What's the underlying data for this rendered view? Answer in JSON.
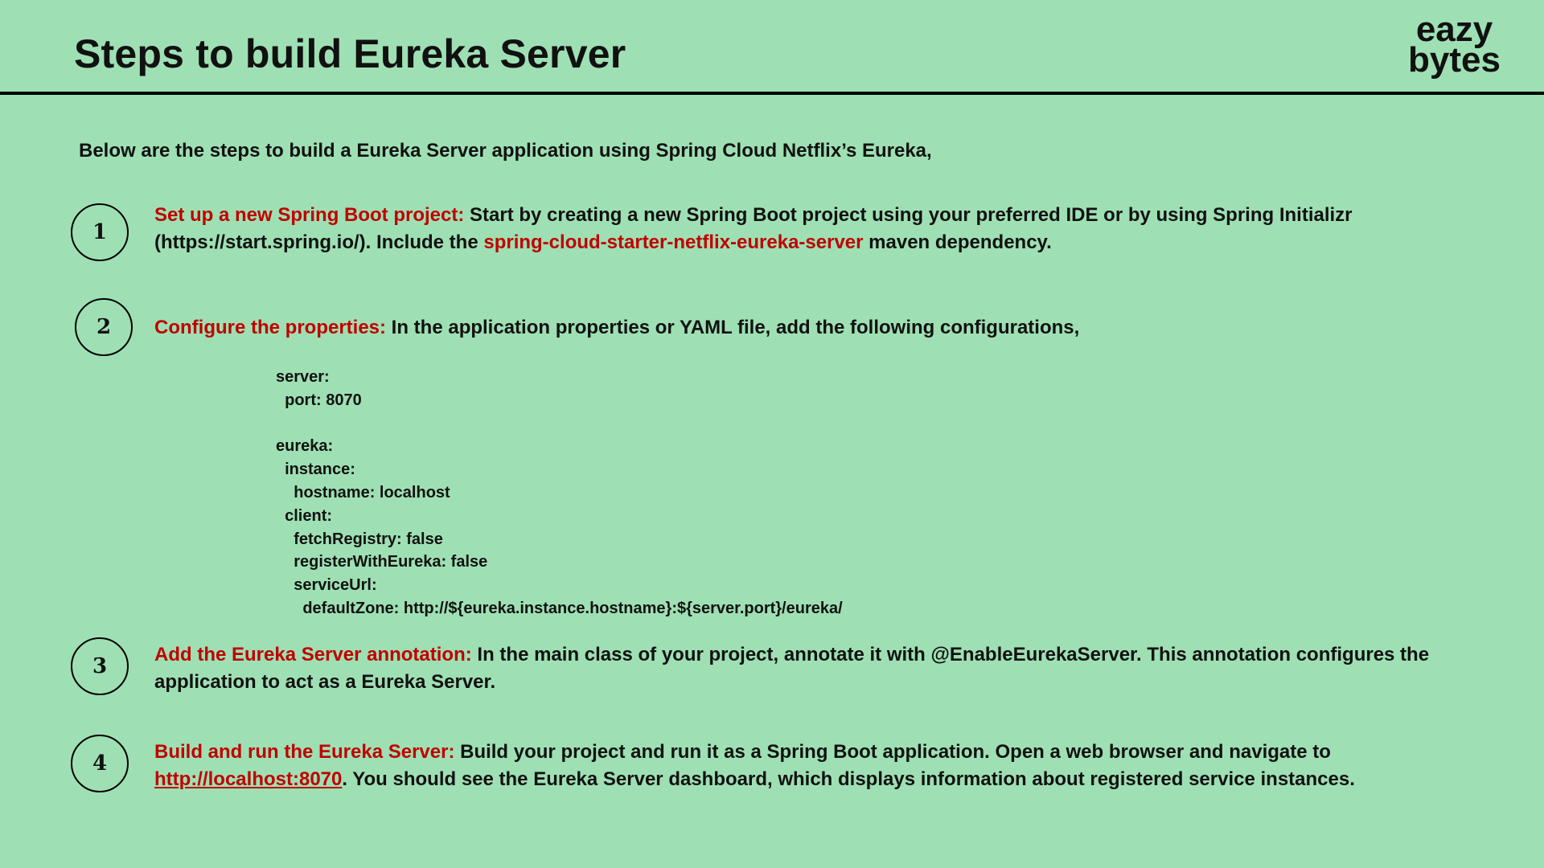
{
  "header": {
    "title": "Steps to build Eureka Server",
    "logo_line1": "eazy",
    "logo_line2": "bytes"
  },
  "intro": "Below are the steps to build a Eureka Server application using Spring Cloud Netflix’s Eureka,",
  "steps": [
    {
      "number": "1",
      "heading": "Set up a new Spring Boot project:",
      "text_a": " Start by creating a new Spring Boot project using your preferred IDE or by using Spring Initializr (https://start.spring.io/). Include the ",
      "highlight": "spring-cloud-starter-netflix-eureka-server",
      "text_b": " maven dependency."
    },
    {
      "number": "2",
      "heading": "Configure the properties:",
      "text": " In the application properties or YAML file, add the following configurations,"
    },
    {
      "number": "3",
      "heading": "Add the Eureka Server annotation:",
      "text": " In the main class of your project, annotate it with @EnableEurekaServer. This annotation configures the application to act as a Eureka Server."
    },
    {
      "number": "4",
      "heading": "Build and run the Eureka Server:",
      "text_a": " Build your project and run it as a Spring Boot application. Open a web browser and navigate to ",
      "link": "http://localhost:8070",
      "text_b": ". You should see the Eureka Server dashboard, which displays information about registered service instances."
    }
  ],
  "config_code": "server:\n  port: 8070\n\neureka:\n  instance:\n    hostname: localhost\n  client:\n    fetchRegistry: false\n    registerWithEureka: false\n    serviceUrl:\n      defaultZone: http://${eureka.instance.hostname}:${server.port}/eureka/",
  "colors": {
    "background": "#9ee0b4",
    "highlight": "#c00000",
    "text": "#111111"
  }
}
